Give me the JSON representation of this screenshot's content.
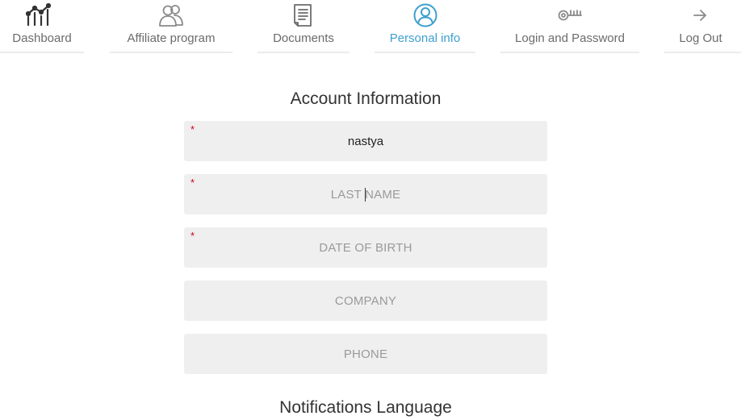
{
  "nav": {
    "tabs": [
      {
        "label": "Dashboard",
        "icon": "chart-icon",
        "active": false
      },
      {
        "label": "Affiliate program",
        "icon": "users-icon",
        "active": false
      },
      {
        "label": "Documents",
        "icon": "document-icon",
        "active": false
      },
      {
        "label": "Personal info",
        "icon": "user-circle-icon",
        "active": true
      },
      {
        "label": "Login and Password",
        "icon": "key-icon",
        "active": false
      },
      {
        "label": "Log Out",
        "icon": "arrow-right-icon",
        "active": false
      }
    ]
  },
  "form": {
    "title": "Account Information",
    "fields": [
      {
        "name": "first_name",
        "value": "nastya",
        "placeholder": "",
        "required": true
      },
      {
        "name": "last_name",
        "value": "",
        "placeholder": "LAST NAME",
        "required": true
      },
      {
        "name": "date_of_birth",
        "value": "",
        "placeholder": "DATE OF BIRTH",
        "required": true
      },
      {
        "name": "company",
        "value": "",
        "placeholder": "COMPANY",
        "required": false
      },
      {
        "name": "phone",
        "value": "",
        "placeholder": "PHONE",
        "required": false
      }
    ],
    "required_mark": "*"
  },
  "notifications": {
    "title": "Notifications Language"
  },
  "colors": {
    "accent": "#3ea0cf",
    "required": "#d0021b",
    "field_bg": "#efefef",
    "nav_text": "#6b6b6b"
  }
}
